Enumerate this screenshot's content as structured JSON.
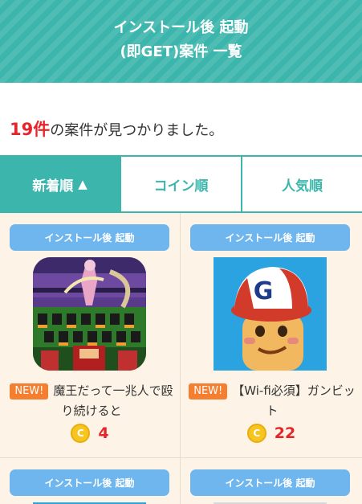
{
  "header": {
    "title_line1": "インストール後 起動",
    "title_line2": "(即GET)案件 一覧"
  },
  "result": {
    "count": "19件",
    "suffix": "の案件が見つかりました。"
  },
  "sort_tabs": [
    {
      "label": "新着順",
      "arrow": "▲",
      "active": true
    },
    {
      "label": "コイン順",
      "active": false
    },
    {
      "label": "人気順",
      "active": false
    }
  ],
  "cards": [
    {
      "tag": "インストール後 起動",
      "new_label": "NEW!",
      "title": "魔王だって一兆人で殴り続けると",
      "coin_symbol": "C",
      "coins": "4",
      "icon": "pixel-army-game-icon"
    },
    {
      "tag": "インストール後 起動",
      "new_label": "NEW!",
      "title": "【Wi-fi必須】ガンビット",
      "coin_symbol": "C",
      "coins": "22",
      "icon": "baseball-cap-character-icon"
    },
    {
      "tag": "インストール後 起動"
    },
    {
      "tag": "インストール後 起動"
    }
  ],
  "colors": {
    "accent": "#3cb6ad",
    "tag": "#6fb6ee",
    "new_badge": "#f47f30",
    "coin": "#f7c51e",
    "coin_value": "#e5252a",
    "card_bg": "#fdf3e6"
  }
}
